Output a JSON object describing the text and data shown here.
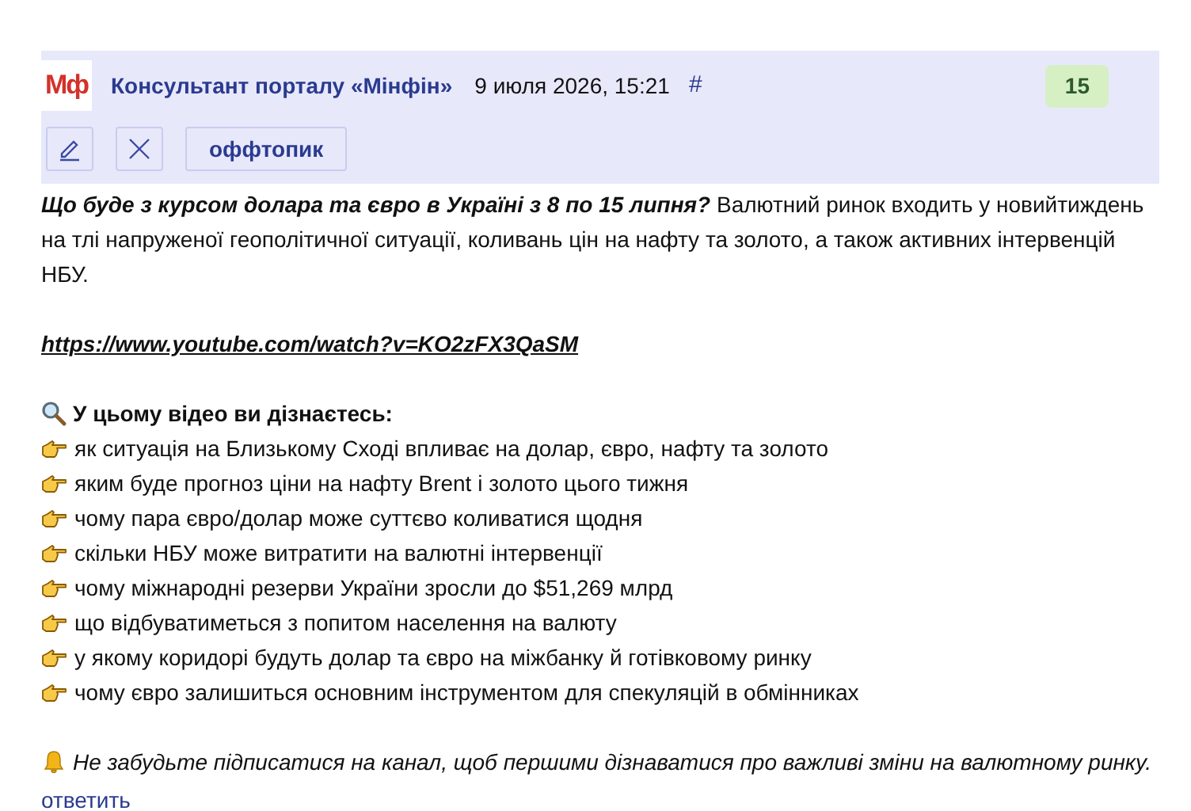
{
  "header": {
    "logo_text": "Мф",
    "author": "Консультант порталу «Мінфін»",
    "datetime": "9 июля 2026, 15:21",
    "anchor": "#",
    "score": "15"
  },
  "actions": [
    {
      "kind": "edit"
    },
    {
      "kind": "delete"
    },
    {
      "kind": "tag",
      "label": "оффтопик"
    }
  ],
  "post": {
    "lead": "Що буде з курсом долара та євро в Україні з 8 по 15 липня?",
    "intro": "Валютний ринок входить у новийтиждень на тлі напруженої геополітичної ситуації, коливань цін на нафту та золото, а також активних інтервенцій НБУ.",
    "link": "https://www.youtube.com/watch?v=KO2zFX3QaSM",
    "heading": "У цьому відео ви дізнаєтесь:",
    "items": [
      "як ситуація на Близькому Сході впливає на долар, євро, нафту та золото",
      "яким буде прогноз ціни на нафту Brent і золото цього тижня",
      "чому пара євро/долар може суттєво коливатися щодня",
      "скільки НБУ може витратити на валютні інтервенції",
      "чому міжнародні резерви України зросли до $51,269 млрд",
      "що відбуватиметься з попитом населення на валюту",
      "у якому коридорі будуть долар та євро на міжбанку й готівковому ринку",
      "чому євро залишиться основним інструментом для спекуляцій в обмінниках"
    ],
    "note": "Не забудьте підписатися на канал, щоб першими дізнаватися про важливі зміни на валютному ринку."
  },
  "reply": "ответить"
}
